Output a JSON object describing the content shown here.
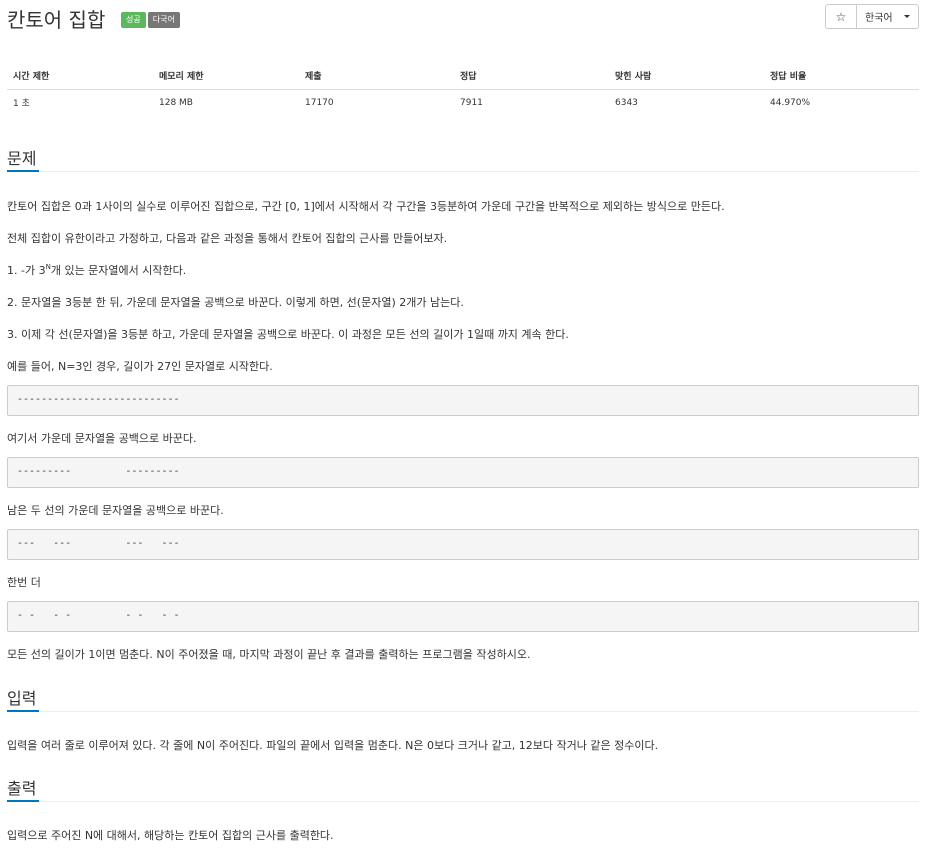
{
  "problem": {
    "title": "칸토어 집합",
    "badges": {
      "success": "성공",
      "multilang": "다국어"
    }
  },
  "toolbar": {
    "star_glyph": "☆",
    "language": "한국어"
  },
  "info_table": {
    "headers": [
      "시간 제한",
      "메모리 제한",
      "제출",
      "정답",
      "맞힌 사람",
      "정답 비율"
    ],
    "values": [
      "1 초",
      "128 MB",
      "17170",
      "7911",
      "6343",
      "44.970%"
    ]
  },
  "sections": {
    "problem": {
      "heading": "문제",
      "p1": "칸토어 집합은 0과 1사이의 실수로 이루어진 집합으로, 구간 [0, 1]에서 시작해서 각 구간을 3등분하여 가운데 구간을 반복적으로 제외하는 방식으로 만든다.",
      "p2": "전체 집합이 유한이라고 가정하고, 다음과 같은 과정을 통해서 칸토어 집합의 근사를 만들어보자.",
      "p3_pre": "1. -가 3",
      "p3_sup": "N",
      "p3_post": "개 있는 문자열에서 시작한다.",
      "p4": "2. 문자열을 3등분 한 뒤, 가운데 문자열을 공백으로 바꾼다. 이렇게 하면, 선(문자열) 2개가 남는다.",
      "p5": "3. 이제 각 선(문자열)을 3등분 하고, 가운데 문자열을 공백으로 바꾼다. 이 과정은 모든 선의 길이가 1일때 까지 계속 한다.",
      "p6": "예를 들어, N=3인 경우, 길이가 27인 문자열로 시작한다.",
      "code1": "---------------------------",
      "p7": "여기서 가운데 문자열을 공백으로 바꾼다.",
      "code2": "---------         ---------",
      "p8": "남은 두 선의 가운데 문자열을 공백으로 바꾼다.",
      "code3": "---   ---         ---   ---",
      "p9": "한번 더",
      "code4": "- -   - -         - -   - -",
      "p10": "모든 선의 길이가 1이면 멈춘다. N이 주어졌을 때, 마지막 과정이 끝난 후 결과를 출력하는 프로그램을 작성하시오."
    },
    "input": {
      "heading": "입력",
      "text": "입력을 여러 줄로 이루어져 있다. 각 줄에 N이 주어진다. 파일의 끝에서 입력을 멈춘다. N은 0보다 크거나 같고, 12보다 작거나 같은 정수이다."
    },
    "output": {
      "heading": "출력",
      "text": "입력으로 주어진 N에 대해서, 해당하는 칸토어 집합의 근사를 출력한다."
    }
  },
  "colors": {
    "accent": "#0076c0",
    "success": "#5cb85c",
    "muted_badge": "#777777"
  }
}
